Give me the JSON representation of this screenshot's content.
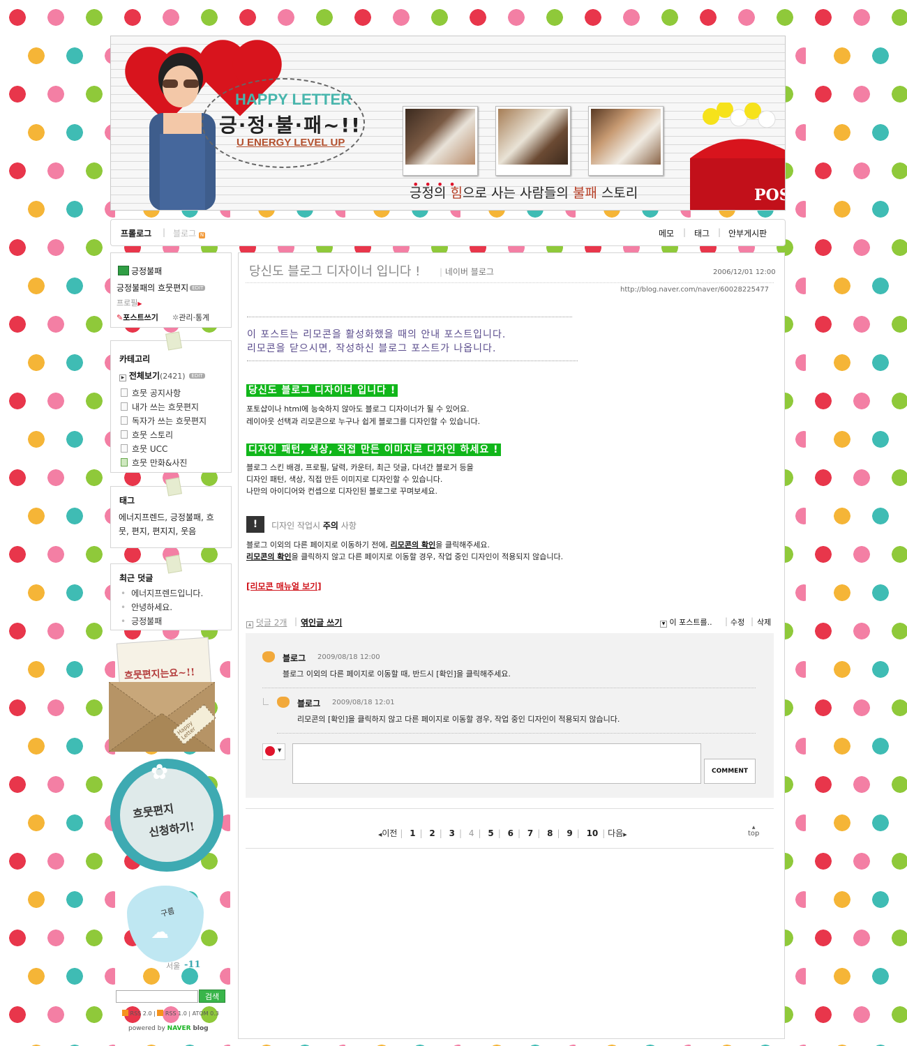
{
  "header": {
    "happy_letter": "HAPPY LETTER",
    "slogan": "긍·정·불·패~!!",
    "energy": "U ENERGY LEVEL UP",
    "story_pre": "긍정의 ",
    "story_him": "힘",
    "story_mid": "으로 사는 사람들의 ",
    "story_bul": "불패",
    "story_post": " 스토리",
    "mailbox_text": "POST"
  },
  "nav": {
    "prologue": "프롤로그",
    "blog": "블로그",
    "memo": "메모",
    "tag": "태그",
    "guestbook": "안부게시판"
  },
  "profile": {
    "name": "긍정불패",
    "title": "긍정불패의 흐뭇편지",
    "edit": "EDIT",
    "profile_link": "프로필",
    "write": "포스트쓰기",
    "manage": "관리·통계"
  },
  "category": {
    "title": "카테고리",
    "all_label": "전체보기",
    "all_count": "(2421)",
    "edit": "EDIT",
    "items": [
      "흐뭇 공지사항",
      "내가 쓰는 흐뭇편지",
      "독자가 쓰는 흐뭇편지",
      "흐뭇 스토리",
      "흐뭇 UCC",
      "흐뭇 만화&사진"
    ]
  },
  "tags": {
    "title": "태그",
    "line1": "에너지프렌드, 긍정불패, 흐",
    "line2": "뭇, 편지, 편지지, 웃음"
  },
  "recent_comments": {
    "title": "최근 덧글",
    "items": [
      "에너지프렌드입니다.",
      "안녕하세요.",
      "긍정불패"
    ]
  },
  "widgets": {
    "envelope_text": "흐뭇편지는요~!!",
    "envelope_tag": "Happy Letter",
    "apply_line1": "흐뭇편지",
    "apply_line2": "신청하기!",
    "weather_label": "구름",
    "weather_city": "서울",
    "weather_temp": "-11"
  },
  "search": {
    "button": "검색",
    "placeholder": ""
  },
  "feeds": {
    "rss2": "RSS 2.0",
    "rss1": "RSS 1.0",
    "atom": "ATOM 0.3",
    "powered": "powered by",
    "naver": "NAVER",
    "blog": "blog"
  },
  "post": {
    "title": "당신도 블로그 디자이너 입니다 !",
    "source": "네이버 블로그",
    "date": "2006/12/01 12:00",
    "url": "http://blog.naver.com/naver/60028225477",
    "notice1": "이 포스트는 리모콘을 활성화했을 때의 안내 포스트입니다.",
    "notice2": "리모콘을 닫으시면, 작성하신 블로그 포스트가 나옵니다.",
    "heading1": "당신도 블로그 디자이너 입니다 !",
    "para1_1": "포토샵이나 html에 능숙하지 않아도 블로그 디자이너가 될 수 있어요.",
    "para1_2": "레이아웃 선택과 리모콘으로 누구나 쉽게 블로그를 디자인할 수 있습니다.",
    "heading2": "디자인 패턴, 색상, 직접 만든 이미지로 디자인 하세요 !",
    "para2_1": "블로그 스킨 배경, 프로필, 달력, 카운터, 최근 덧글, 다녀간 블로거 등을",
    "para2_2": "디자인 패턴, 색상, 직접 만든 이미지로 디자인할 수 있습니다.",
    "para2_3": "나만의 아이디어와 컨셉으로 디자인된 블로그로 꾸며보세요.",
    "caution_pre": "디자인 작업시 ",
    "caution_bold": "주의",
    "caution_post": " 사항",
    "caution1_pre": "블로그 이외의 다른 페이지로 이동하기 전에, ",
    "caution1_link": "리모콘의 확인",
    "caution1_post": "을 클릭해주세요.",
    "caution2_link": "리모콘의 확인",
    "caution2_post": "을 클릭하지 않고 다른 페이지로 이동할 경우, 작업 중인 디자인이 적용되지 않습니다.",
    "manual_link": "[리모콘 매뉴얼 보기]"
  },
  "post_footer": {
    "comments": "덧글 2개",
    "trackback": "엮인글 쓰기",
    "this_post": "이 포스트를..",
    "modify": "수정",
    "delete": "삭제"
  },
  "comments": [
    {
      "author": "블로그",
      "date": "2009/08/18 12:00",
      "text": "블로그 이외의 다른 페이지로 이동할 때, 반드시 [확인]을 클릭해주세요."
    },
    {
      "author": "블로그",
      "date": "2009/08/18 12:01",
      "text": "리모콘의 [확인]을 클릭하지 않고 다른 페이지로 이동할 경우, 작업 중인 디자인이 적용되지 않습니다."
    }
  ],
  "comment_form": {
    "submit": "COMMENT",
    "value": ""
  },
  "pager": {
    "prev": "이전",
    "next": "다음",
    "pages": [
      "1",
      "2",
      "3",
      "4",
      "5",
      "6",
      "7",
      "8",
      "9",
      "10"
    ],
    "current": "4",
    "top": "top"
  },
  "colors": {
    "accent_green": "#10b61a",
    "link_red": "#d0141b",
    "notice_purple": "#5a4c8c"
  }
}
